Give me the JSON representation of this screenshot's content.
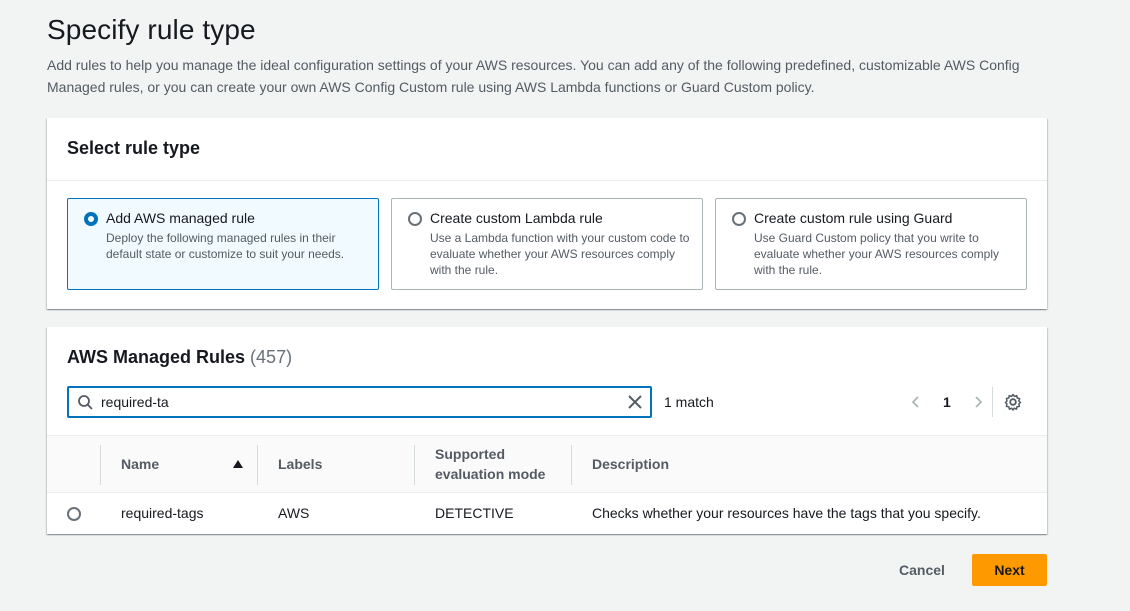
{
  "page": {
    "title": "Specify rule type",
    "description": "Add rules to help you manage the ideal configuration settings of your AWS resources. You can add any of the following predefined, customizable AWS Config Managed rules, or you can create your own AWS Config Custom rule using AWS Lambda functions or Guard Custom policy."
  },
  "rule_type": {
    "header": "Select rule type",
    "options": [
      {
        "title": "Add AWS managed rule",
        "description": "Deploy the following managed rules in their default state or customize to suit your needs.",
        "selected": true
      },
      {
        "title": "Create custom Lambda rule",
        "description": "Use a Lambda function with your custom code to evaluate whether your AWS resources comply with the rule.",
        "selected": false
      },
      {
        "title": "Create custom rule using Guard",
        "description": "Use Guard Custom policy that you write to evaluate whether your AWS resources comply with the rule.",
        "selected": false
      }
    ]
  },
  "managed_rules": {
    "header": "AWS Managed Rules",
    "count": "(457)",
    "search_value": "required-ta",
    "match_text": "1 match",
    "page_number": "1",
    "columns": [
      "Name",
      "Labels",
      "Supported evaluation mode",
      "Description"
    ],
    "rows": [
      {
        "name": "required-tags",
        "labels": "AWS",
        "mode": "DETECTIVE",
        "description": "Checks whether your resources have the tags that you specify."
      }
    ]
  },
  "footer": {
    "cancel_label": "Cancel",
    "next_label": "Next"
  },
  "colors": {
    "accent": "#0073bb",
    "primary_button": "#ff9900",
    "background": "#f2f3f3"
  }
}
